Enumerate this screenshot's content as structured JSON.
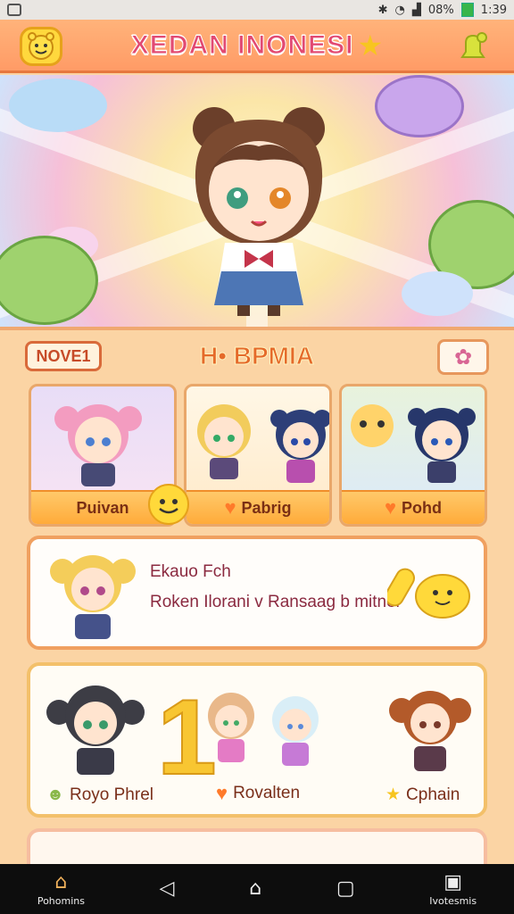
{
  "status_bar": {
    "battery_text": "08%",
    "time": "1:39"
  },
  "header": {
    "title": "XEDAN INONESI"
  },
  "section": {
    "badge": "NOVE1",
    "title": "H• BPMIA"
  },
  "featured_cards": [
    {
      "label": "Puivan"
    },
    {
      "label": "Pabrig"
    },
    {
      "label": "Pohd"
    }
  ],
  "wide_card": {
    "line1": "Ekauo Fch",
    "line2": "Roken Ilorani v Ransaag b mitnel"
  },
  "big_card": {
    "number": "1",
    "labels": [
      "Royo Phrel",
      "Rovalten",
      "Cphain"
    ]
  },
  "nav": [
    {
      "label": "Pohomins",
      "icon": "home-icon"
    },
    {
      "label": "",
      "icon": "back-icon"
    },
    {
      "label": "",
      "icon": "home-circle-icon"
    },
    {
      "label": "",
      "icon": "recents-icon"
    },
    {
      "label": "Ivotesmis",
      "icon": "profile-icon"
    }
  ],
  "colors": {
    "accent": "#ff9b66",
    "title": "#e24a72",
    "card_border": "#f0a060"
  }
}
